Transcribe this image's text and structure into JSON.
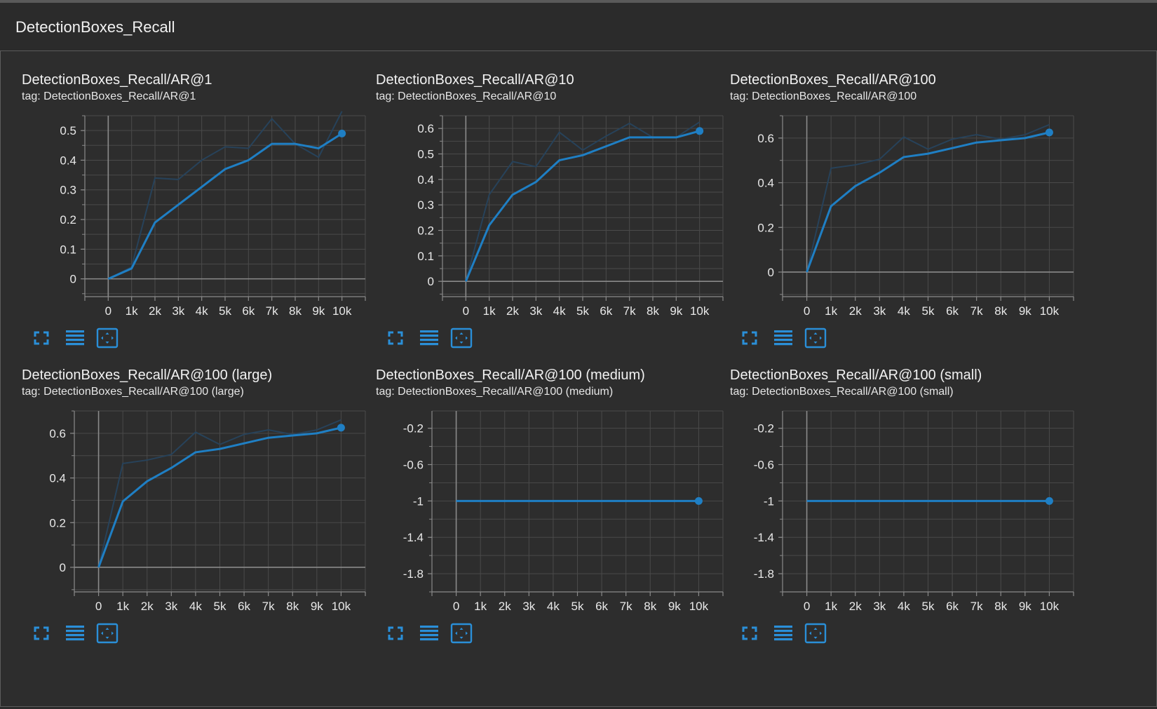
{
  "header": {
    "title": "DetectionBoxes_Recall"
  },
  "colors": {
    "background": "#2b2b2b",
    "grid": "#4a4a4a",
    "axis": "#8a8a8a",
    "series": "#1f7fc4",
    "raw_series": "#27425a",
    "icon": "#2a8fd8"
  },
  "toolbar_icons": [
    "expand-icon",
    "list-icon",
    "fit-domain-icon"
  ],
  "chart_data": [
    {
      "type": "line",
      "title": "DetectionBoxes_Recall/AR@1",
      "tag": "tag: DetectionBoxes_Recall/AR@1",
      "x": [
        0,
        1000,
        2000,
        3000,
        4000,
        5000,
        6000,
        7000,
        8000,
        9000,
        10000
      ],
      "x_tick_labels": [
        "0",
        "1k",
        "2k",
        "3k",
        "4k",
        "5k",
        "6k",
        "7k",
        "8k",
        "9k",
        "10k"
      ],
      "xlim": [
        -1000,
        11000
      ],
      "y_ticks": [
        0,
        0.1,
        0.2,
        0.3,
        0.4,
        0.5
      ],
      "y_tick_labels": [
        "0",
        "0.1",
        "0.2",
        "0.3",
        "0.4",
        "0.5"
      ],
      "ylim": [
        -0.06,
        0.55
      ],
      "grid": true,
      "series": [
        {
          "role": "smoothed",
          "values": [
            0,
            0.035,
            0.19,
            0.25,
            0.31,
            0.37,
            0.4,
            0.455,
            0.455,
            0.44,
            0.49
          ]
        },
        {
          "role": "raw",
          "values": [
            0,
            0.04,
            0.34,
            0.335,
            0.4,
            0.445,
            0.44,
            0.54,
            0.455,
            0.41,
            0.565
          ]
        }
      ]
    },
    {
      "type": "line",
      "title": "DetectionBoxes_Recall/AR@10",
      "tag": "tag: DetectionBoxes_Recall/AR@10",
      "x": [
        0,
        1000,
        2000,
        3000,
        4000,
        5000,
        6000,
        7000,
        8000,
        9000,
        10000
      ],
      "x_tick_labels": [
        "0",
        "1k",
        "2k",
        "3k",
        "4k",
        "5k",
        "6k",
        "7k",
        "8k",
        "9k",
        "10k"
      ],
      "xlim": [
        -1000,
        11000
      ],
      "y_ticks": [
        0,
        0.1,
        0.2,
        0.3,
        0.4,
        0.5,
        0.6
      ],
      "y_tick_labels": [
        "0",
        "0.1",
        "0.2",
        "0.3",
        "0.4",
        "0.5",
        "0.6"
      ],
      "ylim": [
        -0.06,
        0.65
      ],
      "grid": true,
      "series": [
        {
          "role": "smoothed",
          "values": [
            0,
            0.22,
            0.34,
            0.39,
            0.475,
            0.495,
            0.53,
            0.565,
            0.565,
            0.565,
            0.59
          ]
        },
        {
          "role": "raw",
          "values": [
            0,
            0.34,
            0.47,
            0.45,
            0.585,
            0.515,
            0.57,
            0.62,
            0.565,
            0.565,
            0.625
          ]
        }
      ]
    },
    {
      "type": "line",
      "title": "DetectionBoxes_Recall/AR@100",
      "tag": "tag: DetectionBoxes_Recall/AR@100",
      "x": [
        0,
        1000,
        2000,
        3000,
        4000,
        5000,
        6000,
        7000,
        8000,
        9000,
        10000
      ],
      "x_tick_labels": [
        "0",
        "1k",
        "2k",
        "3k",
        "4k",
        "5k",
        "6k",
        "7k",
        "8k",
        "9k",
        "10k"
      ],
      "xlim": [
        -1000,
        11000
      ],
      "y_ticks": [
        0,
        0.2,
        0.4,
        0.6
      ],
      "y_tick_labels": [
        "0",
        "0.2",
        "0.4",
        "0.6"
      ],
      "ylim": [
        -0.11,
        0.7
      ],
      "grid": true,
      "series": [
        {
          "role": "smoothed",
          "values": [
            0,
            0.295,
            0.385,
            0.445,
            0.515,
            0.53,
            0.555,
            0.58,
            0.59,
            0.6,
            0.625
          ]
        },
        {
          "role": "raw",
          "values": [
            0,
            0.465,
            0.48,
            0.505,
            0.605,
            0.55,
            0.595,
            0.615,
            0.595,
            0.615,
            0.66
          ]
        }
      ]
    },
    {
      "type": "line",
      "title": "DetectionBoxes_Recall/AR@100 (large)",
      "tag": "tag: DetectionBoxes_Recall/AR@100 (large)",
      "x": [
        0,
        1000,
        2000,
        3000,
        4000,
        5000,
        6000,
        7000,
        8000,
        9000,
        10000
      ],
      "x_tick_labels": [
        "0",
        "1k",
        "2k",
        "3k",
        "4k",
        "5k",
        "6k",
        "7k",
        "8k",
        "9k",
        "10k"
      ],
      "xlim": [
        -1000,
        11000
      ],
      "y_ticks": [
        0,
        0.2,
        0.4,
        0.6
      ],
      "y_tick_labels": [
        "0",
        "0.2",
        "0.4",
        "0.6"
      ],
      "ylim": [
        -0.11,
        0.7
      ],
      "grid": true,
      "series": [
        {
          "role": "smoothed",
          "values": [
            0,
            0.295,
            0.385,
            0.445,
            0.515,
            0.53,
            0.555,
            0.58,
            0.59,
            0.6,
            0.625
          ]
        },
        {
          "role": "raw",
          "values": [
            0,
            0.465,
            0.48,
            0.505,
            0.605,
            0.55,
            0.595,
            0.615,
            0.595,
            0.615,
            0.66
          ]
        }
      ]
    },
    {
      "type": "line",
      "title": "DetectionBoxes_Recall/AR@100 (medium)",
      "tag": "tag: DetectionBoxes_Recall/AR@100 (medium)",
      "x": [
        0,
        1000,
        2000,
        3000,
        4000,
        5000,
        6000,
        7000,
        8000,
        9000,
        10000
      ],
      "x_tick_labels": [
        "0",
        "1k",
        "2k",
        "3k",
        "4k",
        "5k",
        "6k",
        "7k",
        "8k",
        "9k",
        "10k"
      ],
      "xlim": [
        -1000,
        11000
      ],
      "y_ticks": [
        -0.2,
        -0.6,
        -1,
        -1.4,
        -1.8
      ],
      "y_tick_labels": [
        "-0.2",
        "-0.6",
        "-1",
        "-1.4",
        "-1.8"
      ],
      "ylim": [
        -2.0,
        -0.01
      ],
      "grid": true,
      "series": [
        {
          "role": "smoothed",
          "values": [
            -1,
            -1,
            -1,
            -1,
            -1,
            -1,
            -1,
            -1,
            -1,
            -1,
            -1
          ]
        }
      ]
    },
    {
      "type": "line",
      "title": "DetectionBoxes_Recall/AR@100 (small)",
      "tag": "tag: DetectionBoxes_Recall/AR@100 (small)",
      "x": [
        0,
        1000,
        2000,
        3000,
        4000,
        5000,
        6000,
        7000,
        8000,
        9000,
        10000
      ],
      "x_tick_labels": [
        "0",
        "1k",
        "2k",
        "3k",
        "4k",
        "5k",
        "6k",
        "7k",
        "8k",
        "9k",
        "10k"
      ],
      "xlim": [
        -1000,
        11000
      ],
      "y_ticks": [
        -0.2,
        -0.6,
        -1,
        -1.4,
        -1.8
      ],
      "y_tick_labels": [
        "-0.2",
        "-0.6",
        "-1",
        "-1.4",
        "-1.8"
      ],
      "ylim": [
        -2.0,
        -0.01
      ],
      "grid": true,
      "series": [
        {
          "role": "smoothed",
          "values": [
            -1,
            -1,
            -1,
            -1,
            -1,
            -1,
            -1,
            -1,
            -1,
            -1,
            -1
          ]
        }
      ]
    }
  ]
}
